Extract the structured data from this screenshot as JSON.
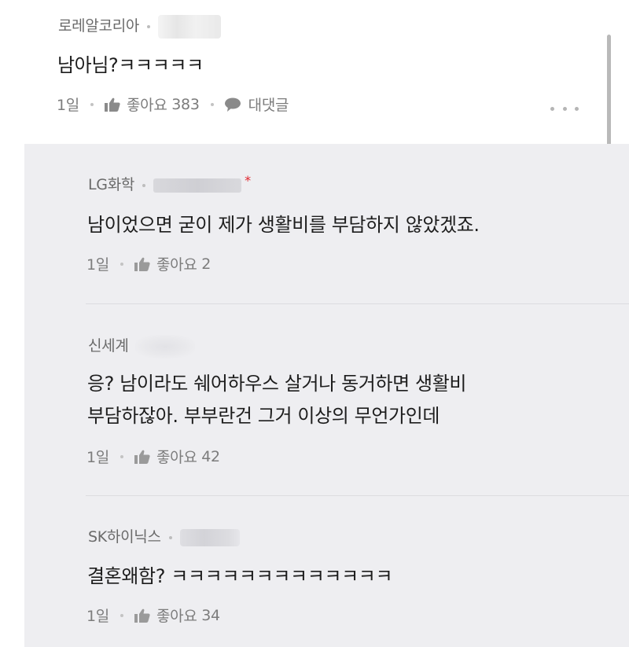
{
  "top_comment": {
    "company": "로레알코리아",
    "text": "남아님?ㅋㅋㅋㅋㅋ",
    "time": "1일",
    "like_label": "좋아요",
    "like_count": "383",
    "reply_label": "대댓글"
  },
  "replies": [
    {
      "company": "LG화학",
      "verified_mark": "*",
      "lines": [
        "남이었으면 굳이 제가 생활비를 부담하지 않았겠죠."
      ],
      "time": "1일",
      "like_label": "좋아요",
      "like_count": "2"
    },
    {
      "company": "신세계",
      "lines": [
        "응? 남이라도 쉐어하우스 살거나 동거하면 생활비",
        "부담하잖아. 부부란건 그거 이상의 무언가인데"
      ],
      "time": "1일",
      "like_label": "좋아요",
      "like_count": "42"
    },
    {
      "company": "SK하이닉스",
      "lines": [
        "결혼왜함? ㅋㅋㅋㅋㅋㅋㅋㅋㅋㅋㅋㅋㅋ"
      ],
      "time": "1일",
      "like_label": "좋아요",
      "like_count": "34"
    }
  ],
  "colors": {
    "reply_background": "#eeeef1",
    "verified_mark": "#e0242c",
    "meta_text": "#7c7c7c"
  },
  "icons": [
    "thumbs-up-icon",
    "speech-bubble-icon",
    "more-dots-icon"
  ]
}
